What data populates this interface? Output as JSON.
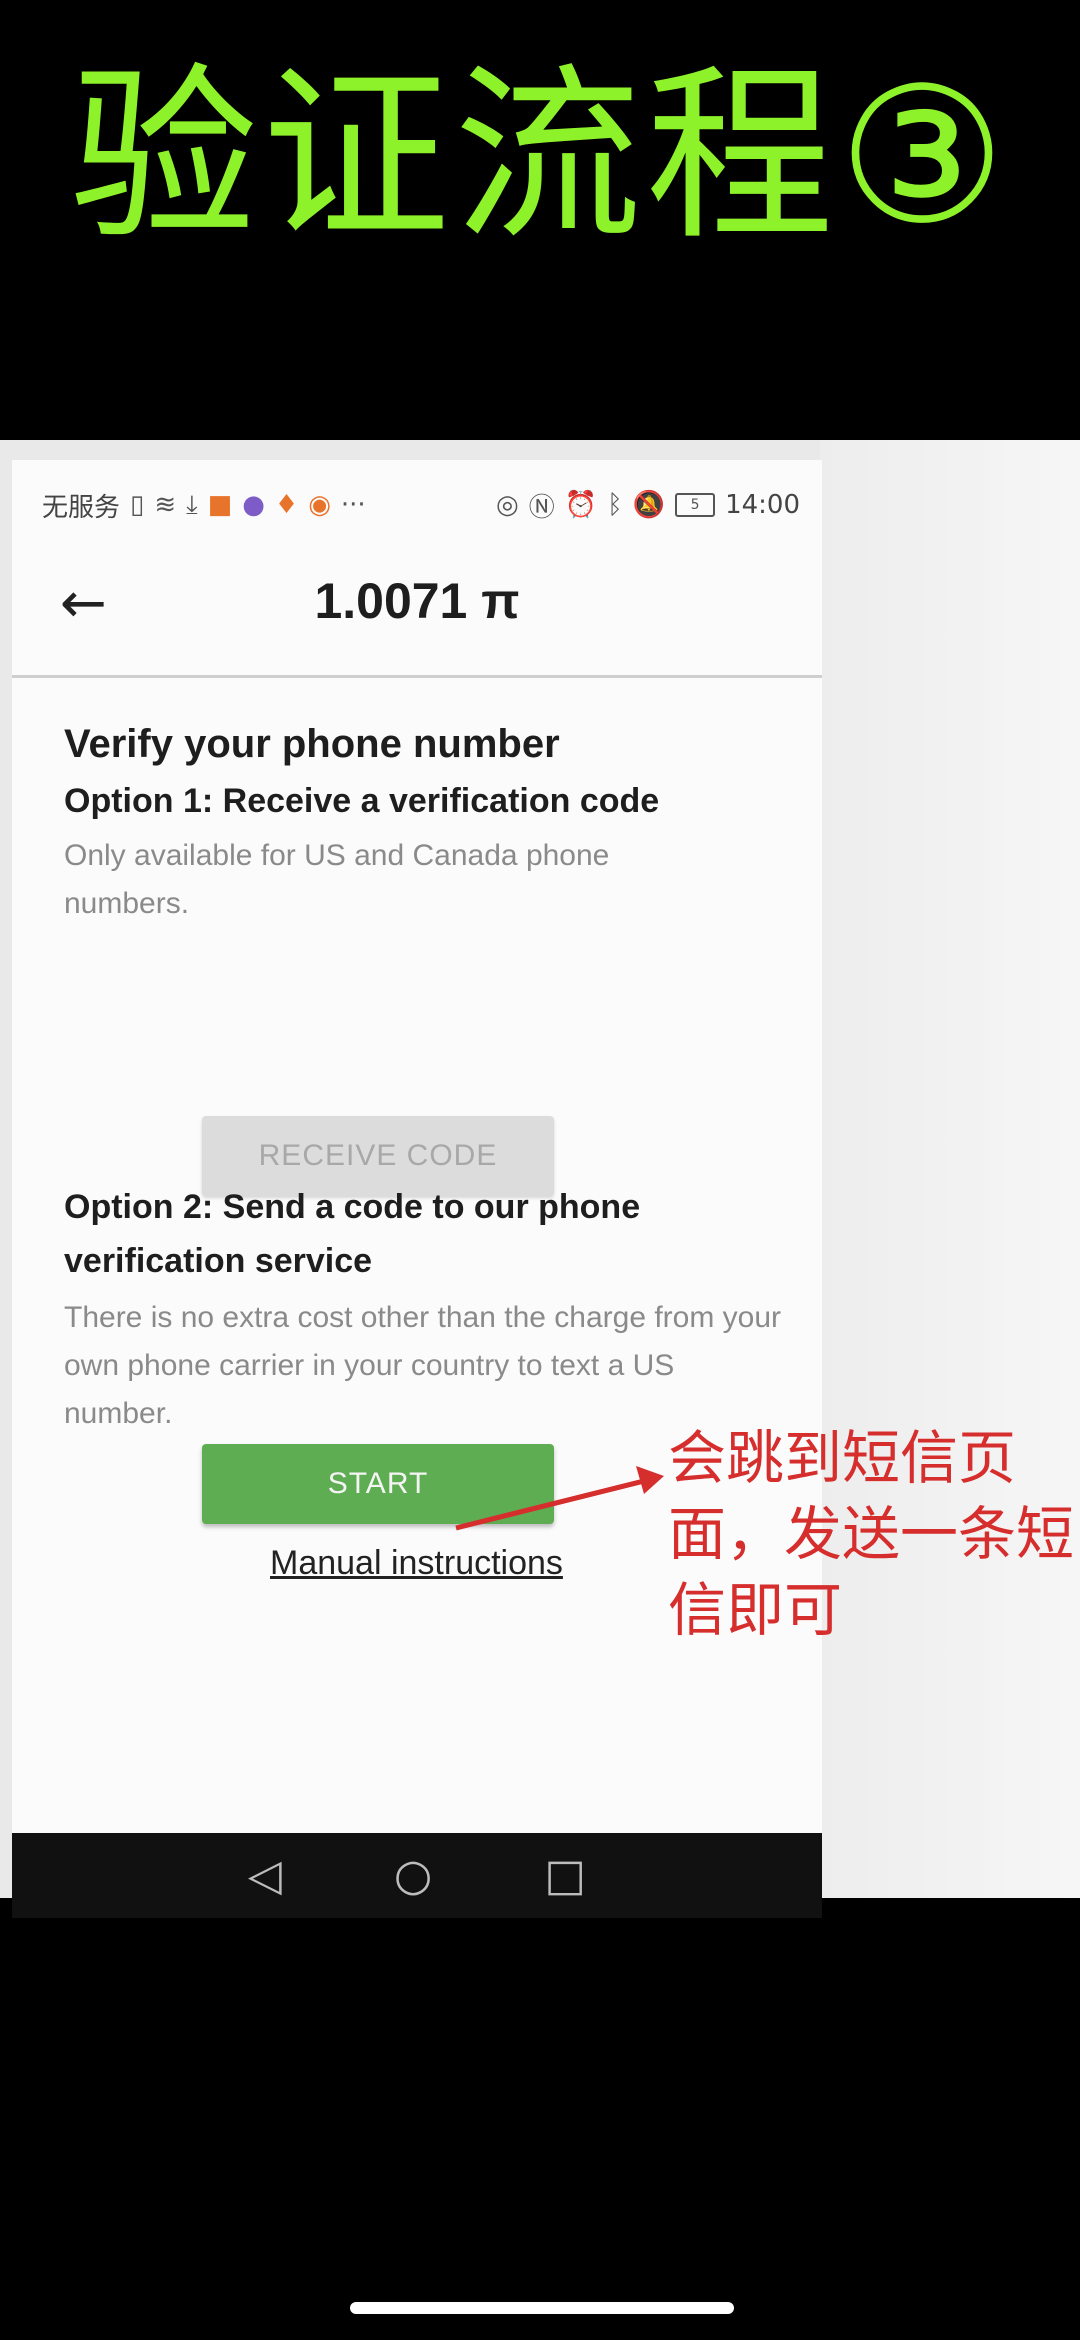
{
  "banner": {
    "title": "验证流程③"
  },
  "statusbar": {
    "carrier": "无服务",
    "time": "14:00",
    "battery": "5"
  },
  "appbar": {
    "balance": "1.0071 π",
    "back_icon": "back-arrow-icon"
  },
  "content": {
    "heading": "Verify your phone number",
    "option1_title": "Option 1: Receive a verification code",
    "option1_desc": "Only available for US and Canada phone numbers.",
    "receive_button": "RECEIVE CODE",
    "option2_title": "Option 2: Send a code to our phone verification service",
    "option2_desc": "There is no extra cost other than the charge from your own phone carrier in your country to text a US number.",
    "start_button": "START",
    "manual_link": "Manual instructions"
  },
  "annotation": {
    "text": "会跳到短信页面，发送一条短信即可",
    "color": "#d62d2d"
  },
  "colors": {
    "banner_text": "#8ef22a",
    "start_button": "#5fad52",
    "disabled_button": "#dcdcdc"
  }
}
